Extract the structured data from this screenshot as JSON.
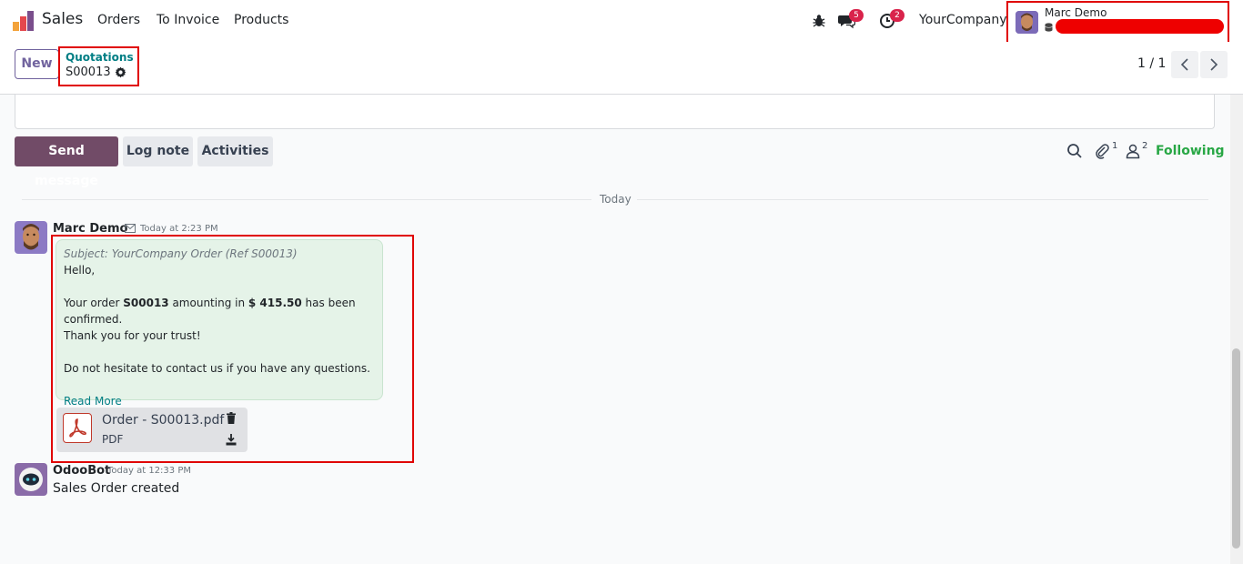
{
  "navbar": {
    "app_name": "Sales",
    "menu": [
      "Orders",
      "To Invoice",
      "Products"
    ],
    "messages_count": "5",
    "activities_count": "2",
    "company": "YourCompany",
    "user_name": "Marc Demo"
  },
  "control_panel": {
    "new_label": "New",
    "breadcrumb_parent": "Quotations",
    "breadcrumb_current": "S00013",
    "pager": "1 / 1"
  },
  "chatter": {
    "send_message": "Send message",
    "log_note": "Log note",
    "activities": "Activities",
    "attachments_count": "1",
    "followers_count": "2",
    "following": "Following",
    "date_separator": "Today",
    "messages": [
      {
        "author": "Marc Demo",
        "time": "Today at 2:23 PM",
        "subject": "Subject: YourCompany Order (Ref S00013)",
        "greeting": "Hello,",
        "line1_a": "Your order ",
        "order_ref": "S00013",
        "line1_b": " amounting in ",
        "amount": "$ 415.50",
        "line1_c": " has been confirmed.",
        "line2": "Thank you for your trust!",
        "line3": "Do not hesitate to contact us if you have any questions.",
        "read_more": "Read More",
        "attachment_name": "Order - S00013.pdf",
        "attachment_type": "PDF"
      },
      {
        "author": "OdooBot",
        "time": "Today at 12:33 PM",
        "body": "Sales Order created"
      }
    ]
  },
  "colors": {
    "primary": "#714b67",
    "link": "#017e84",
    "following": "#28a745",
    "highlight": "#e00000",
    "badge": "#d9234b"
  }
}
